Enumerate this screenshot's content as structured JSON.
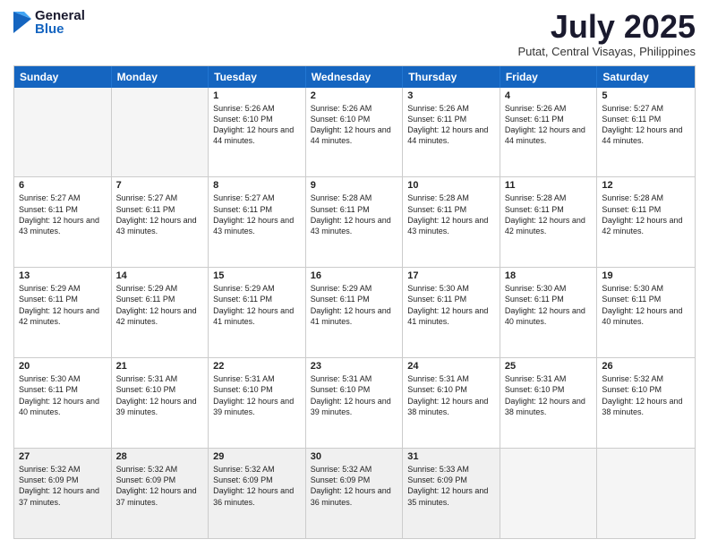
{
  "logo": {
    "general": "General",
    "blue": "Blue"
  },
  "header": {
    "month_year": "July 2025",
    "location": "Putat, Central Visayas, Philippines"
  },
  "days_of_week": [
    "Sunday",
    "Monday",
    "Tuesday",
    "Wednesday",
    "Thursday",
    "Friday",
    "Saturday"
  ],
  "weeks": [
    [
      {
        "day": "",
        "text": "",
        "empty": true
      },
      {
        "day": "",
        "text": "",
        "empty": true
      },
      {
        "day": "1",
        "text": "Sunrise: 5:26 AM\nSunset: 6:10 PM\nDaylight: 12 hours and 44 minutes."
      },
      {
        "day": "2",
        "text": "Sunrise: 5:26 AM\nSunset: 6:10 PM\nDaylight: 12 hours and 44 minutes."
      },
      {
        "day": "3",
        "text": "Sunrise: 5:26 AM\nSunset: 6:11 PM\nDaylight: 12 hours and 44 minutes."
      },
      {
        "day": "4",
        "text": "Sunrise: 5:26 AM\nSunset: 6:11 PM\nDaylight: 12 hours and 44 minutes."
      },
      {
        "day": "5",
        "text": "Sunrise: 5:27 AM\nSunset: 6:11 PM\nDaylight: 12 hours and 44 minutes."
      }
    ],
    [
      {
        "day": "6",
        "text": "Sunrise: 5:27 AM\nSunset: 6:11 PM\nDaylight: 12 hours and 43 minutes."
      },
      {
        "day": "7",
        "text": "Sunrise: 5:27 AM\nSunset: 6:11 PM\nDaylight: 12 hours and 43 minutes."
      },
      {
        "day": "8",
        "text": "Sunrise: 5:27 AM\nSunset: 6:11 PM\nDaylight: 12 hours and 43 minutes."
      },
      {
        "day": "9",
        "text": "Sunrise: 5:28 AM\nSunset: 6:11 PM\nDaylight: 12 hours and 43 minutes."
      },
      {
        "day": "10",
        "text": "Sunrise: 5:28 AM\nSunset: 6:11 PM\nDaylight: 12 hours and 43 minutes."
      },
      {
        "day": "11",
        "text": "Sunrise: 5:28 AM\nSunset: 6:11 PM\nDaylight: 12 hours and 42 minutes."
      },
      {
        "day": "12",
        "text": "Sunrise: 5:28 AM\nSunset: 6:11 PM\nDaylight: 12 hours and 42 minutes."
      }
    ],
    [
      {
        "day": "13",
        "text": "Sunrise: 5:29 AM\nSunset: 6:11 PM\nDaylight: 12 hours and 42 minutes."
      },
      {
        "day": "14",
        "text": "Sunrise: 5:29 AM\nSunset: 6:11 PM\nDaylight: 12 hours and 42 minutes."
      },
      {
        "day": "15",
        "text": "Sunrise: 5:29 AM\nSunset: 6:11 PM\nDaylight: 12 hours and 41 minutes."
      },
      {
        "day": "16",
        "text": "Sunrise: 5:29 AM\nSunset: 6:11 PM\nDaylight: 12 hours and 41 minutes."
      },
      {
        "day": "17",
        "text": "Sunrise: 5:30 AM\nSunset: 6:11 PM\nDaylight: 12 hours and 41 minutes."
      },
      {
        "day": "18",
        "text": "Sunrise: 5:30 AM\nSunset: 6:11 PM\nDaylight: 12 hours and 40 minutes."
      },
      {
        "day": "19",
        "text": "Sunrise: 5:30 AM\nSunset: 6:11 PM\nDaylight: 12 hours and 40 minutes."
      }
    ],
    [
      {
        "day": "20",
        "text": "Sunrise: 5:30 AM\nSunset: 6:11 PM\nDaylight: 12 hours and 40 minutes."
      },
      {
        "day": "21",
        "text": "Sunrise: 5:31 AM\nSunset: 6:10 PM\nDaylight: 12 hours and 39 minutes."
      },
      {
        "day": "22",
        "text": "Sunrise: 5:31 AM\nSunset: 6:10 PM\nDaylight: 12 hours and 39 minutes."
      },
      {
        "day": "23",
        "text": "Sunrise: 5:31 AM\nSunset: 6:10 PM\nDaylight: 12 hours and 39 minutes."
      },
      {
        "day": "24",
        "text": "Sunrise: 5:31 AM\nSunset: 6:10 PM\nDaylight: 12 hours and 38 minutes."
      },
      {
        "day": "25",
        "text": "Sunrise: 5:31 AM\nSunset: 6:10 PM\nDaylight: 12 hours and 38 minutes."
      },
      {
        "day": "26",
        "text": "Sunrise: 5:32 AM\nSunset: 6:10 PM\nDaylight: 12 hours and 38 minutes."
      }
    ],
    [
      {
        "day": "27",
        "text": "Sunrise: 5:32 AM\nSunset: 6:09 PM\nDaylight: 12 hours and 37 minutes."
      },
      {
        "day": "28",
        "text": "Sunrise: 5:32 AM\nSunset: 6:09 PM\nDaylight: 12 hours and 37 minutes."
      },
      {
        "day": "29",
        "text": "Sunrise: 5:32 AM\nSunset: 6:09 PM\nDaylight: 12 hours and 36 minutes."
      },
      {
        "day": "30",
        "text": "Sunrise: 5:32 AM\nSunset: 6:09 PM\nDaylight: 12 hours and 36 minutes."
      },
      {
        "day": "31",
        "text": "Sunrise: 5:33 AM\nSunset: 6:09 PM\nDaylight: 12 hours and 35 minutes."
      },
      {
        "day": "",
        "text": "",
        "empty": true
      },
      {
        "day": "",
        "text": "",
        "empty": true
      }
    ]
  ]
}
